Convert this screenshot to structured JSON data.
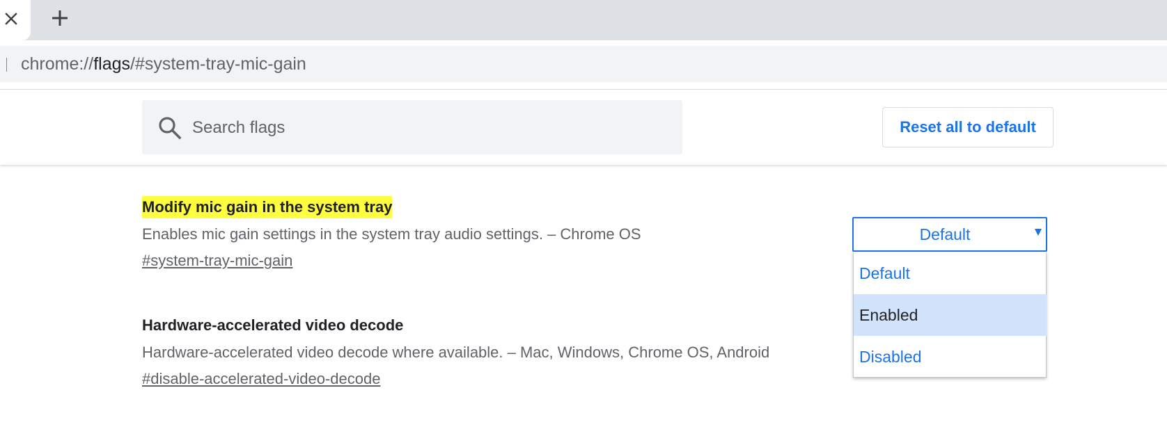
{
  "tabstrip": {
    "close_glyph": "×",
    "new_tab_glyph": "+",
    "icons": [
      "close-icon",
      "plus-icon"
    ]
  },
  "omnibox": {
    "url_prefix": "chrome://",
    "url_host": "flags",
    "url_path": "/#system-tray-mic-gain"
  },
  "header": {
    "search_placeholder": "Search flags",
    "search_value": "",
    "search_icon": "search-icon",
    "reset_label": "Reset all to default"
  },
  "experiments": [
    {
      "title": "Modify mic gain in the system tray",
      "description": "Enables mic gain settings in the system tray audio settings. – Chrome OS",
      "link": "#system-tray-mic-gain",
      "highlighted": true
    },
    {
      "title": "Hardware-accelerated video decode",
      "description": "Hardware-accelerated video decode where available. – Mac, Windows, Chrome OS, Android",
      "link": "#disable-accelerated-video-decode",
      "highlighted": false
    }
  ],
  "select": {
    "value": "Default",
    "options": [
      "Default",
      "Enabled",
      "Disabled"
    ],
    "hovered_option": "Enabled"
  },
  "colors": {
    "accent": "#1a73e8",
    "highlight": "#ffff40",
    "option_hover": "#d2e3fc",
    "text_primary": "#202124",
    "text_secondary": "#5f6368",
    "tabstrip_bg": "#dee1e6",
    "omnibox_bg": "#f1f3f4"
  }
}
